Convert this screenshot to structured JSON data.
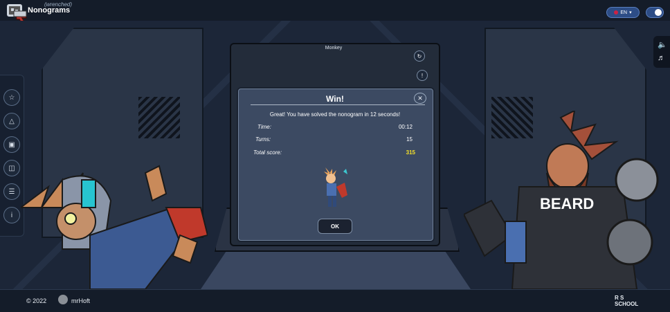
{
  "header": {
    "app_title": "Nonograms",
    "app_subtitle": "(wrenched)",
    "language": "EN"
  },
  "board": {
    "title": "Monkey"
  },
  "modal": {
    "title": "Win!",
    "message": "Great! You have solved the nonogram in 12 seconds!",
    "stats": [
      {
        "label": "Time:",
        "value": "00:12"
      },
      {
        "label": "Turns:",
        "value": "15"
      },
      {
        "label": "Total score:",
        "value": "315"
      }
    ],
    "ok_label": "OK"
  },
  "footer": {
    "copyright": "© 2022",
    "author": "mrHoft",
    "school_logo": "RS SCHOOL"
  },
  "right_rail_icons": [
    "volume-icon",
    "music-off-icon"
  ],
  "left_rail_icons": [
    "star-icon",
    "shapes-icon",
    "save-icon",
    "load-icon",
    "list-icon",
    "info-icon"
  ],
  "board_icons": [
    "restart-icon",
    "hint-icon"
  ],
  "colors": {
    "accent": "#2d4d86",
    "score": "#f5e12a"
  }
}
